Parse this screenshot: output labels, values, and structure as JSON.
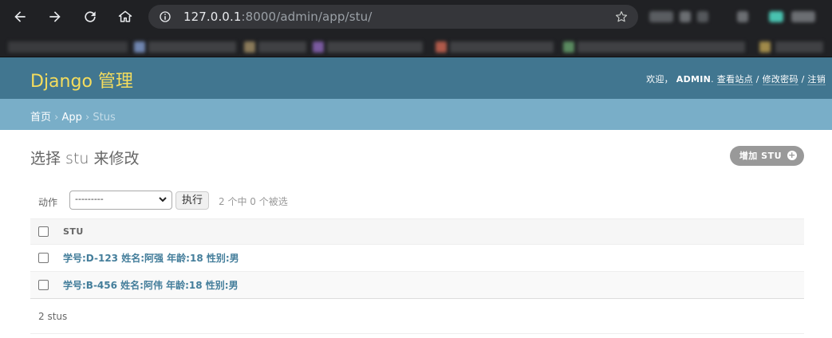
{
  "browser": {
    "url_host": "127.0.0.1",
    "url_rest": ":8000/admin/app/stu/"
  },
  "header": {
    "branding": "Django 管理",
    "welcome": "欢迎，",
    "username": "ADMIN",
    "view_site": "查看站点",
    "change_password": "修改密码",
    "logout": "注销",
    "sep": " / ",
    "dot": ". "
  },
  "breadcrumbs": {
    "home": "首页",
    "app": "App",
    "current": "Stus",
    "sep": " › "
  },
  "main": {
    "title": "选择 stu 来修改",
    "add_button": "增加 STU",
    "actions": {
      "label": "动作",
      "selected_option": "---------",
      "go_button": "执行",
      "counter": "2 个中 0 个被选"
    },
    "table": {
      "column_header": "STU",
      "rows": [
        {
          "label": "学号:D-123 姓名:阿强 年龄:18 性别:男"
        },
        {
          "label": "学号:B-456 姓名:阿伟 年龄:18 性别:男"
        }
      ]
    },
    "paginator": "2 stus"
  },
  "colors": {
    "header_bg": "#417690",
    "breadcrumb_bg": "#79aec8",
    "branding": "#f5dd5d",
    "link": "#447e9b"
  }
}
